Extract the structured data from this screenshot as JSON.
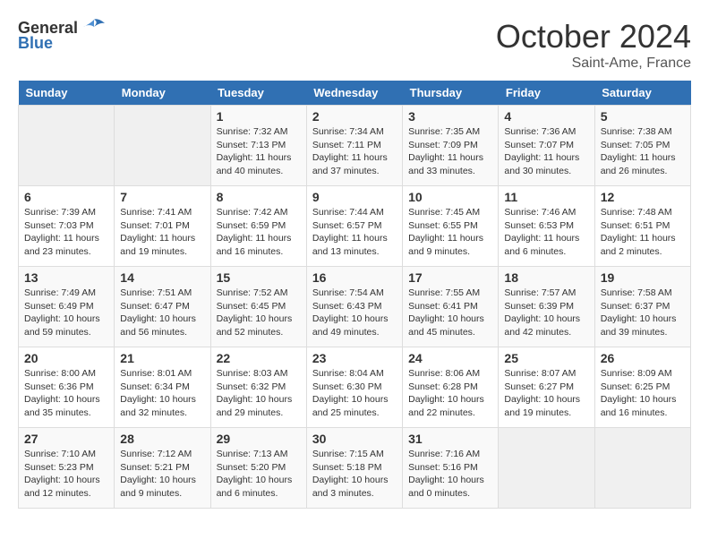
{
  "header": {
    "logo_general": "General",
    "logo_blue": "Blue",
    "month_title": "October 2024",
    "location": "Saint-Ame, France"
  },
  "days_of_week": [
    "Sunday",
    "Monday",
    "Tuesday",
    "Wednesday",
    "Thursday",
    "Friday",
    "Saturday"
  ],
  "weeks": [
    [
      {
        "day": "",
        "info": ""
      },
      {
        "day": "",
        "info": ""
      },
      {
        "day": "1",
        "info": "Sunrise: 7:32 AM\nSunset: 7:13 PM\nDaylight: 11 hours and 40 minutes."
      },
      {
        "day": "2",
        "info": "Sunrise: 7:34 AM\nSunset: 7:11 PM\nDaylight: 11 hours and 37 minutes."
      },
      {
        "day": "3",
        "info": "Sunrise: 7:35 AM\nSunset: 7:09 PM\nDaylight: 11 hours and 33 minutes."
      },
      {
        "day": "4",
        "info": "Sunrise: 7:36 AM\nSunset: 7:07 PM\nDaylight: 11 hours and 30 minutes."
      },
      {
        "day": "5",
        "info": "Sunrise: 7:38 AM\nSunset: 7:05 PM\nDaylight: 11 hours and 26 minutes."
      }
    ],
    [
      {
        "day": "6",
        "info": "Sunrise: 7:39 AM\nSunset: 7:03 PM\nDaylight: 11 hours and 23 minutes."
      },
      {
        "day": "7",
        "info": "Sunrise: 7:41 AM\nSunset: 7:01 PM\nDaylight: 11 hours and 19 minutes."
      },
      {
        "day": "8",
        "info": "Sunrise: 7:42 AM\nSunset: 6:59 PM\nDaylight: 11 hours and 16 minutes."
      },
      {
        "day": "9",
        "info": "Sunrise: 7:44 AM\nSunset: 6:57 PM\nDaylight: 11 hours and 13 minutes."
      },
      {
        "day": "10",
        "info": "Sunrise: 7:45 AM\nSunset: 6:55 PM\nDaylight: 11 hours and 9 minutes."
      },
      {
        "day": "11",
        "info": "Sunrise: 7:46 AM\nSunset: 6:53 PM\nDaylight: 11 hours and 6 minutes."
      },
      {
        "day": "12",
        "info": "Sunrise: 7:48 AM\nSunset: 6:51 PM\nDaylight: 11 hours and 2 minutes."
      }
    ],
    [
      {
        "day": "13",
        "info": "Sunrise: 7:49 AM\nSunset: 6:49 PM\nDaylight: 10 hours and 59 minutes."
      },
      {
        "day": "14",
        "info": "Sunrise: 7:51 AM\nSunset: 6:47 PM\nDaylight: 10 hours and 56 minutes."
      },
      {
        "day": "15",
        "info": "Sunrise: 7:52 AM\nSunset: 6:45 PM\nDaylight: 10 hours and 52 minutes."
      },
      {
        "day": "16",
        "info": "Sunrise: 7:54 AM\nSunset: 6:43 PM\nDaylight: 10 hours and 49 minutes."
      },
      {
        "day": "17",
        "info": "Sunrise: 7:55 AM\nSunset: 6:41 PM\nDaylight: 10 hours and 45 minutes."
      },
      {
        "day": "18",
        "info": "Sunrise: 7:57 AM\nSunset: 6:39 PM\nDaylight: 10 hours and 42 minutes."
      },
      {
        "day": "19",
        "info": "Sunrise: 7:58 AM\nSunset: 6:37 PM\nDaylight: 10 hours and 39 minutes."
      }
    ],
    [
      {
        "day": "20",
        "info": "Sunrise: 8:00 AM\nSunset: 6:36 PM\nDaylight: 10 hours and 35 minutes."
      },
      {
        "day": "21",
        "info": "Sunrise: 8:01 AM\nSunset: 6:34 PM\nDaylight: 10 hours and 32 minutes."
      },
      {
        "day": "22",
        "info": "Sunrise: 8:03 AM\nSunset: 6:32 PM\nDaylight: 10 hours and 29 minutes."
      },
      {
        "day": "23",
        "info": "Sunrise: 8:04 AM\nSunset: 6:30 PM\nDaylight: 10 hours and 25 minutes."
      },
      {
        "day": "24",
        "info": "Sunrise: 8:06 AM\nSunset: 6:28 PM\nDaylight: 10 hours and 22 minutes."
      },
      {
        "day": "25",
        "info": "Sunrise: 8:07 AM\nSunset: 6:27 PM\nDaylight: 10 hours and 19 minutes."
      },
      {
        "day": "26",
        "info": "Sunrise: 8:09 AM\nSunset: 6:25 PM\nDaylight: 10 hours and 16 minutes."
      }
    ],
    [
      {
        "day": "27",
        "info": "Sunrise: 7:10 AM\nSunset: 5:23 PM\nDaylight: 10 hours and 12 minutes."
      },
      {
        "day": "28",
        "info": "Sunrise: 7:12 AM\nSunset: 5:21 PM\nDaylight: 10 hours and 9 minutes."
      },
      {
        "day": "29",
        "info": "Sunrise: 7:13 AM\nSunset: 5:20 PM\nDaylight: 10 hours and 6 minutes."
      },
      {
        "day": "30",
        "info": "Sunrise: 7:15 AM\nSunset: 5:18 PM\nDaylight: 10 hours and 3 minutes."
      },
      {
        "day": "31",
        "info": "Sunrise: 7:16 AM\nSunset: 5:16 PM\nDaylight: 10 hours and 0 minutes."
      },
      {
        "day": "",
        "info": ""
      },
      {
        "day": "",
        "info": ""
      }
    ]
  ]
}
